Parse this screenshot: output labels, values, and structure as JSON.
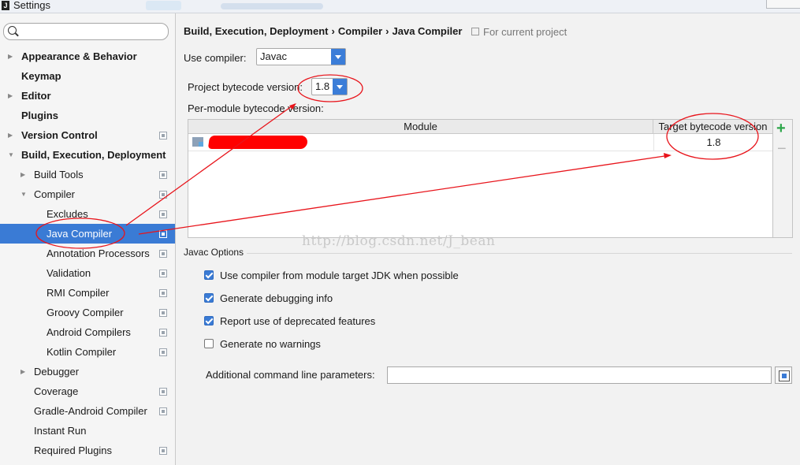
{
  "window": {
    "title": "Settings",
    "app_icon": "intellij-icon",
    "buttons": [
      "close-button"
    ]
  },
  "sidebar": {
    "search_placeholder": "",
    "items": [
      {
        "label": "Appearance & Behavior",
        "bold": true,
        "arrow": "right",
        "config_icon": false
      },
      {
        "label": "Keymap",
        "bold": true,
        "arrow": "",
        "config_icon": false
      },
      {
        "label": "Editor",
        "bold": true,
        "arrow": "right",
        "config_icon": false
      },
      {
        "label": "Plugins",
        "bold": true,
        "arrow": "",
        "config_icon": false
      },
      {
        "label": "Version Control",
        "bold": true,
        "arrow": "right",
        "config_icon": true
      },
      {
        "label": "Build, Execution, Deployment",
        "bold": true,
        "arrow": "down",
        "config_icon": false
      },
      {
        "label": "Build Tools",
        "bold": false,
        "arrow": "right",
        "config_icon": true
      },
      {
        "label": "Compiler",
        "bold": false,
        "arrow": "down",
        "config_icon": true
      },
      {
        "label": "Excludes",
        "bold": false,
        "arrow": "",
        "config_icon": true
      },
      {
        "label": "Java Compiler",
        "bold": false,
        "arrow": "",
        "config_icon": true,
        "selected": true
      },
      {
        "label": "Annotation Processors",
        "bold": false,
        "arrow": "",
        "config_icon": true
      },
      {
        "label": "Validation",
        "bold": false,
        "arrow": "",
        "config_icon": true
      },
      {
        "label": "RMI Compiler",
        "bold": false,
        "arrow": "",
        "config_icon": true
      },
      {
        "label": "Groovy Compiler",
        "bold": false,
        "arrow": "",
        "config_icon": true
      },
      {
        "label": "Android Compilers",
        "bold": false,
        "arrow": "",
        "config_icon": true
      },
      {
        "label": "Kotlin Compiler",
        "bold": false,
        "arrow": "",
        "config_icon": true
      },
      {
        "label": "Debugger",
        "bold": false,
        "arrow": "right",
        "config_icon": false
      },
      {
        "label": "Coverage",
        "bold": false,
        "arrow": "",
        "config_icon": true
      },
      {
        "label": "Gradle-Android Compiler",
        "bold": false,
        "arrow": "",
        "config_icon": true
      },
      {
        "label": "Instant Run",
        "bold": false,
        "arrow": "",
        "config_icon": false
      },
      {
        "label": "Required Plugins",
        "bold": false,
        "arrow": "",
        "config_icon": true
      }
    ]
  },
  "main": {
    "breadcrumb": [
      "Build, Execution, Deployment",
      "Java Compiler"
    ],
    "breadcrumb_full": [
      "Build, Execution, Deployment",
      "Compiler",
      "Java Compiler"
    ],
    "scope_note": "For current project",
    "use_compiler_label": "Use compiler:",
    "use_compiler_value": "Javac",
    "bytecode_label": "Project bytecode version:",
    "bytecode_value": "1.8",
    "per_module_label": "Per-module bytecode version:",
    "table": {
      "columns": [
        "Module",
        "Target bytecode version"
      ],
      "rows": [
        {
          "module": "",
          "target": "1.8"
        }
      ],
      "add_icon": "add-icon",
      "remove_icon": "remove-icon"
    },
    "javac_options_title": "Javac Options",
    "options": [
      {
        "label": "Use compiler from module target JDK when possible",
        "checked": true
      },
      {
        "label": "Generate debugging info",
        "checked": true
      },
      {
        "label": "Report use of deprecated features",
        "checked": true
      },
      {
        "label": "Generate no warnings",
        "checked": false
      }
    ],
    "cmdline_label": "Additional command line parameters:",
    "cmdline_value": ""
  },
  "watermark": "http://blog.csdn.net/J_bean",
  "annotation_color": "#e8141b",
  "selection_color": "#3a7bd5"
}
